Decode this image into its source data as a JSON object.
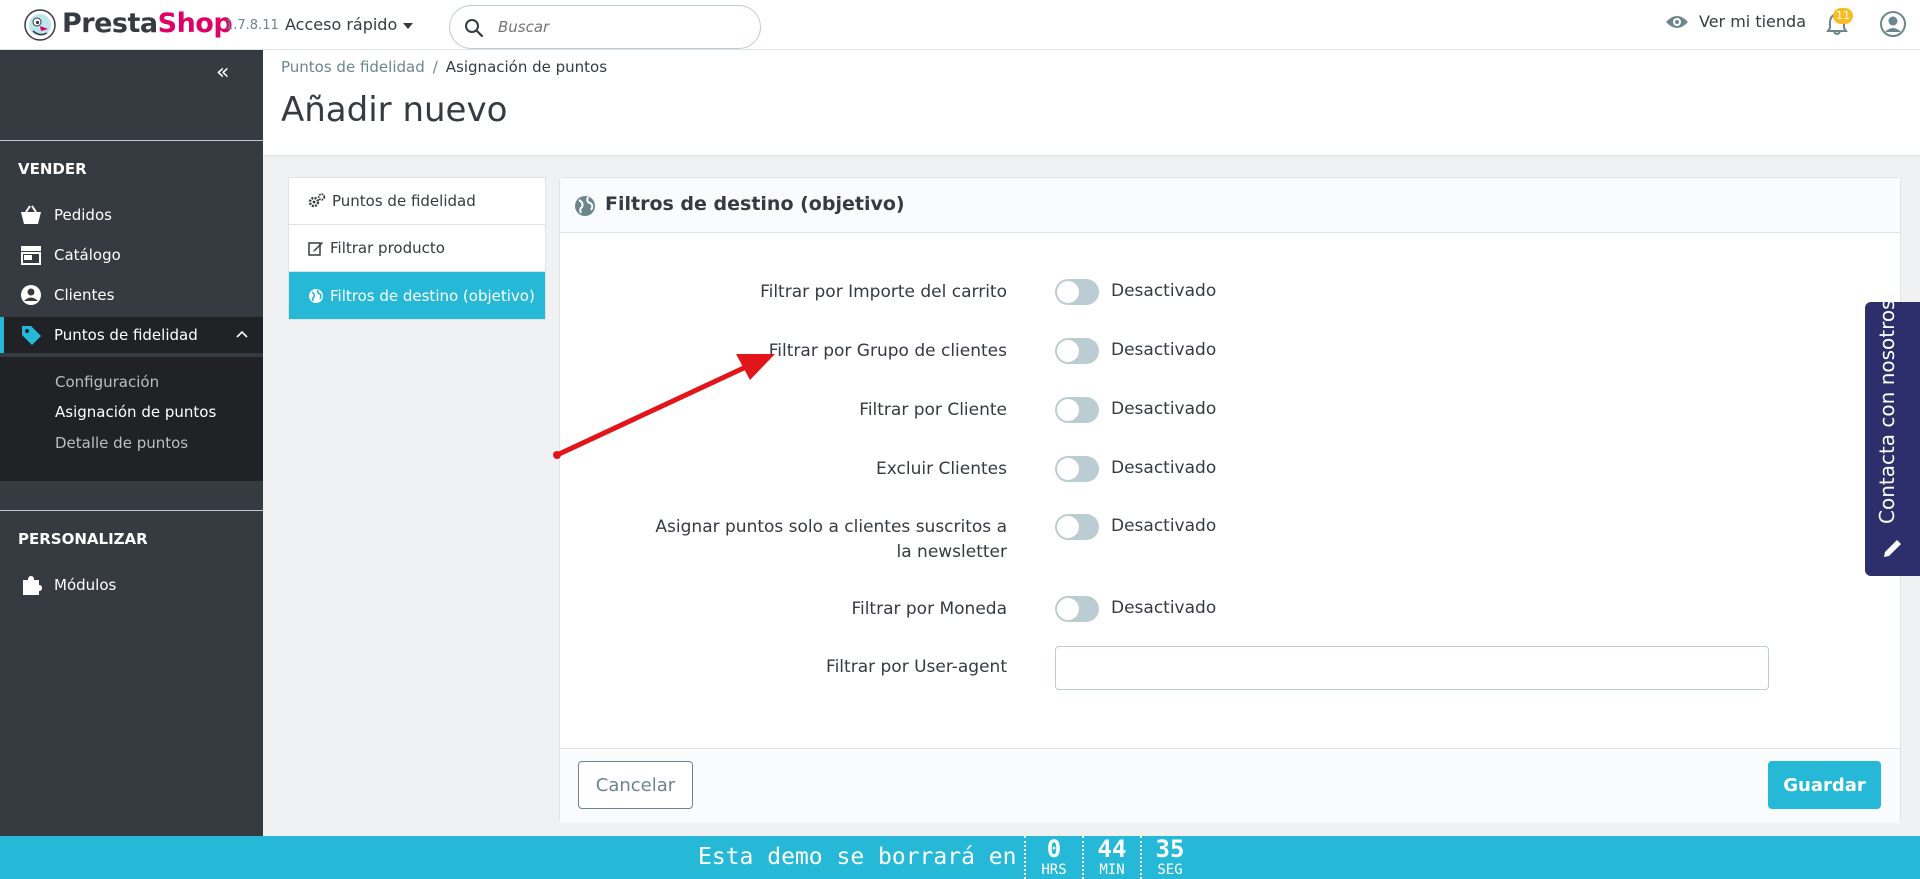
{
  "header": {
    "brand_presta": "Presta",
    "brand_shop": "Shop",
    "version": "1.7.8.11",
    "quick_access": "Acceso rápido",
    "search_placeholder": "Buscar",
    "view_store": "Ver mi tienda",
    "notifications_count": "11"
  },
  "sidebar": {
    "section_sell": "VENDER",
    "items": [
      {
        "label": "Pedidos"
      },
      {
        "label": "Catálogo"
      },
      {
        "label": "Clientes"
      },
      {
        "label": "Puntos de fidelidad"
      }
    ],
    "submenu": [
      {
        "label": "Configuración"
      },
      {
        "label": "Asignación de puntos"
      },
      {
        "label": "Detalle de puntos"
      }
    ],
    "section_customize": "PERSONALIZAR",
    "modules": "Módulos"
  },
  "breadcrumb": {
    "parent": "Puntos de fidelidad",
    "separator": "/",
    "current": "Asignación de puntos"
  },
  "page_title": "Añadir nuevo",
  "tabs": [
    {
      "label": "Puntos de fidelidad"
    },
    {
      "label": "Filtrar producto"
    },
    {
      "label": "Filtros de destino (objetivo)"
    }
  ],
  "panel": {
    "title": "Filtros de destino (objetivo)",
    "rows": [
      {
        "label": "Filtrar por Importe del carrito",
        "state": "Desactivado"
      },
      {
        "label": "Filtrar por Grupo de clientes",
        "state": "Desactivado"
      },
      {
        "label": "Filtrar por Cliente",
        "state": "Desactivado"
      },
      {
        "label": "Excluir Clientes",
        "state": "Desactivado"
      },
      {
        "label": "Asignar puntos solo a clientes suscritos a la newsletter",
        "state": "Desactivado"
      },
      {
        "label": "Filtrar por Moneda",
        "state": "Desactivado"
      }
    ],
    "user_agent_label": "Filtrar por User-agent",
    "user_agent_value": "",
    "cancel": "Cancelar",
    "save": "Guardar"
  },
  "contact_tab": "Contacta con nosotros",
  "demo_bar": {
    "message": "Esta demo se borrará en",
    "hours": "0",
    "hours_unit": "HRS",
    "minutes": "44",
    "minutes_unit": "MIN",
    "seconds": "35",
    "seconds_unit": "SEG"
  },
  "colors": {
    "accent": "#25b9d7",
    "brand_pink": "#df0067",
    "sidebar": "#363a41",
    "badge": "#fbbb22",
    "contact": "#2c2f6b"
  }
}
